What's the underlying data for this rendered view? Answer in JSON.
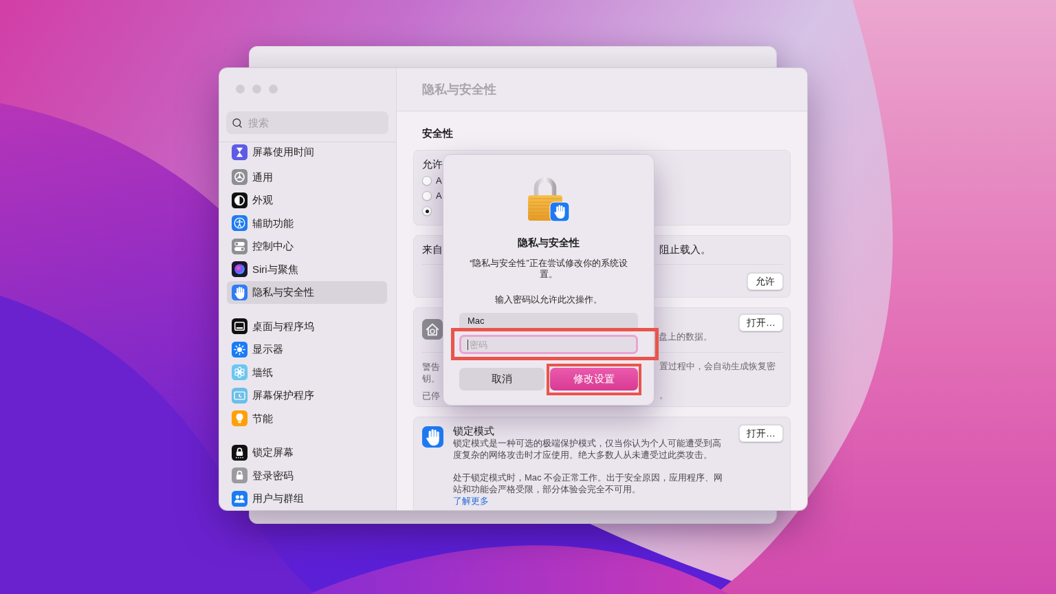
{
  "window": {
    "title": "隐私与安全性"
  },
  "sidebar": {
    "search": {
      "placeholder": "搜索"
    },
    "groups": [
      {
        "items": [
          {
            "label": "屏幕使用时间",
            "selected": false
          }
        ]
      },
      {
        "items": [
          {
            "label": "通用",
            "selected": false
          },
          {
            "label": "外观",
            "selected": false
          },
          {
            "label": "辅助功能",
            "selected": false
          },
          {
            "label": "控制中心",
            "selected": false
          },
          {
            "label": "Siri与聚焦",
            "selected": false
          },
          {
            "label": "隐私与安全性",
            "selected": true
          }
        ]
      },
      {
        "items": [
          {
            "label": "桌面与程序坞",
            "selected": false
          },
          {
            "label": "显示器",
            "selected": false
          },
          {
            "label": "墙纸",
            "selected": false
          },
          {
            "label": "屏幕保护程序",
            "selected": false
          },
          {
            "label": "节能",
            "selected": false
          }
        ]
      },
      {
        "items": [
          {
            "label": "锁定屏幕",
            "selected": false
          },
          {
            "label": "登录密码",
            "selected": false
          },
          {
            "label": "用户与群组",
            "selected": false
          }
        ]
      }
    ]
  },
  "content": {
    "section_title": "安全性",
    "cards": [
      {
        "kind": "radio_group",
        "label": "允许",
        "options": [
          {
            "label": "A",
            "selected": false
          },
          {
            "label": "A",
            "selected": false
          },
          {
            "selected": true
          }
        ]
      },
      {
        "kind": "notice",
        "lines": [
          {
            "left": "来自",
            "right": "阻止载入。"
          }
        ],
        "button": "允许"
      },
      {
        "kind": "filevault",
        "top_text": "盘上的数据。",
        "button": "打开…",
        "lines": [
          {
            "left": "警告",
            "right": "置过程中，会自动生成恢复密"
          },
          {
            "left": "钥。"
          },
          {
            "left": "已停",
            "right": "。"
          }
        ]
      },
      {
        "kind": "feature",
        "title": "锁定模式",
        "paragraphs": [
          "锁定模式是一种可选的极端保护模式，仅当你认为个人可能遭受到高度复杂的网络攻击时才应使用。绝大多数人从未遭受过此类攻击。",
          "处于锁定模式时，Mac 不会正常工作。出于安全原因，应用程序、网站和功能会严格受限，部分体验会完全不可用。"
        ],
        "link": "了解更多",
        "button": "打开…"
      }
    ]
  },
  "dialog": {
    "title": "隐私与安全性",
    "message": "“隐私与安全性”正在尝试修改你的系统设置。",
    "prompt": "输入密码以允许此次操作。",
    "username": {
      "value": "Mac"
    },
    "password": {
      "placeholder": "密码",
      "focused": true,
      "highlighted": true
    },
    "buttons": [
      {
        "label": "取消",
        "kind": "cancel",
        "highlighted": false
      },
      {
        "label": "修改设置",
        "kind": "default",
        "highlighted": true
      }
    ]
  }
}
